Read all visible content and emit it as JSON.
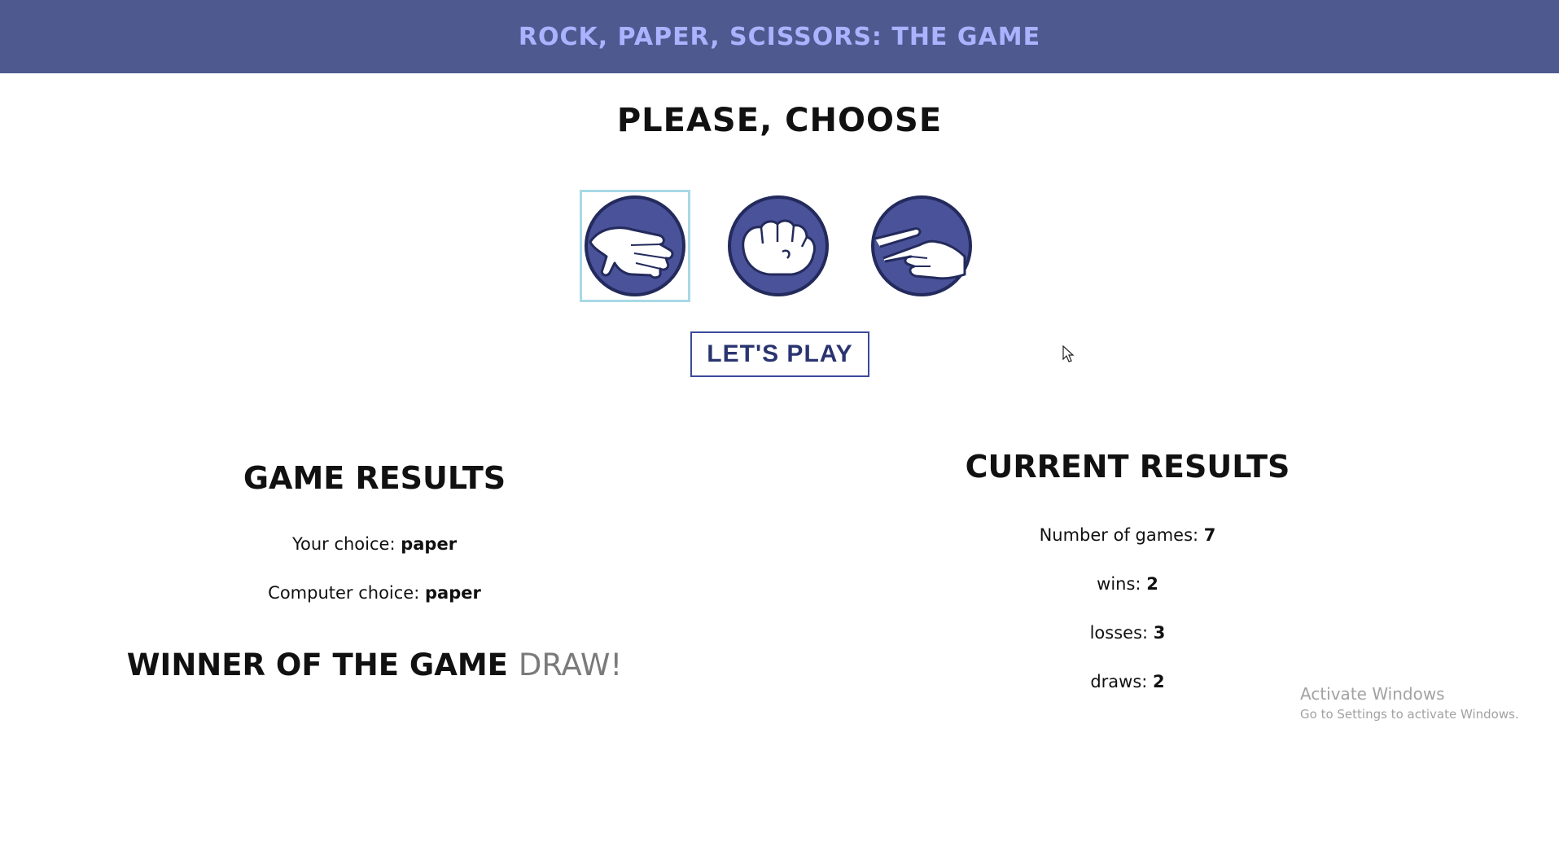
{
  "header": {
    "title": "Rock, Paper, Scissors: The Game"
  },
  "choose": {
    "title": "Please, choose",
    "options": [
      {
        "name": "paper",
        "icon": "paper-hand-icon",
        "selected": true
      },
      {
        "name": "rock",
        "icon": "rock-fist-icon",
        "selected": false
      },
      {
        "name": "scissors",
        "icon": "scissors-hand-icon",
        "selected": false
      }
    ]
  },
  "play_button": {
    "label": "LET'S PLAY"
  },
  "game_results": {
    "title": "Game Results",
    "your_choice_label": "Your choice:",
    "your_choice_value": "paper",
    "computer_choice_label": "Computer choice:",
    "computer_choice_value": "paper",
    "winner_label": "Winner of the game",
    "winner_value": "DRAW!"
  },
  "current_results": {
    "title": "Current Results",
    "games_label": "Number of games:",
    "games_value": "7",
    "wins_label": "wins:",
    "wins_value": "2",
    "losses_label": "losses:",
    "losses_value": "3",
    "draws_label": "draws:",
    "draws_value": "2"
  },
  "watermark": {
    "line1": "Activate Windows",
    "line2": "Go to Settings to activate Windows."
  },
  "colors": {
    "header_bg": "#4e5a8f",
    "header_text": "#a9b3ff",
    "icon_circle": "#4a5299",
    "selected_border": "#a7d9e6"
  }
}
